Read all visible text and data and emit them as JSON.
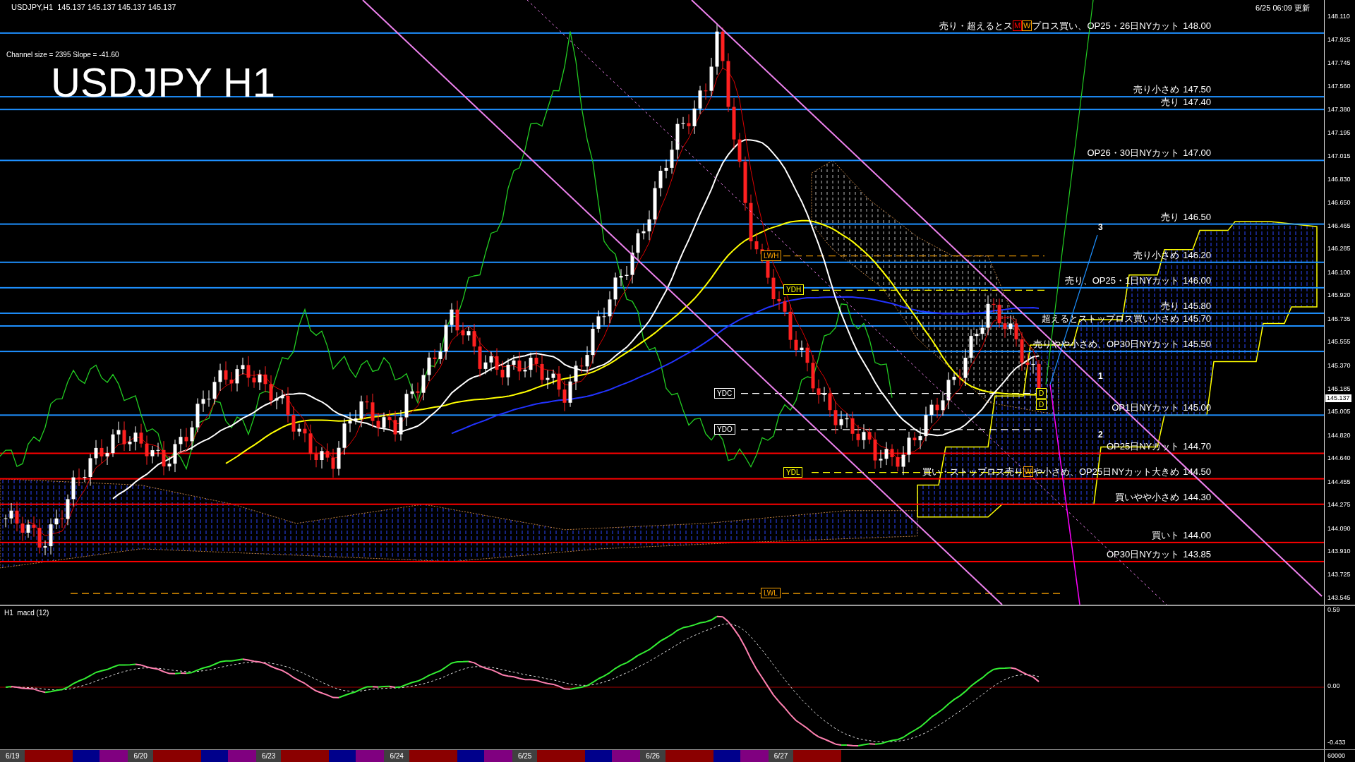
{
  "header": "USDJPY,H1  145.137 145.137 145.137 145.137",
  "updated": "6/25 06:09 更新",
  "channel_info": "Channel size = 2395 Slope = -41.60",
  "chart_title": "USDJPY H1",
  "levels": [
    {
      "parts": [
        {
          "kind": "text",
          "text": "売り・超えるとス"
        },
        {
          "kind": "badge",
          "text": "M",
          "color": "#ff0000"
        },
        {
          "kind": "badge",
          "text": "W",
          "color": "#ffa500"
        },
        {
          "kind": "text",
          "text": "プロス買い、OP25・26日NYカット"
        }
      ],
      "price": "148.00",
      "color": "#1e90ff"
    },
    {
      "parts": [
        {
          "kind": "text",
          "text": "売り小さめ"
        }
      ],
      "price": "147.50",
      "color": "#1e90ff"
    },
    {
      "parts": [
        {
          "kind": "text",
          "text": "売り"
        }
      ],
      "price": "147.40",
      "color": "#1e90ff"
    },
    {
      "parts": [
        {
          "kind": "text",
          "text": "OP26・30日NYカット"
        }
      ],
      "price": "147.00",
      "color": "#1e90ff"
    },
    {
      "parts": [
        {
          "kind": "text",
          "text": "売り"
        }
      ],
      "price": "146.50",
      "color": "#1e90ff"
    },
    {
      "parts": [
        {
          "kind": "text",
          "text": "売り小さめ"
        }
      ],
      "price": "146.20",
      "color": "#1e90ff"
    },
    {
      "parts": [
        {
          "kind": "text",
          "text": "売り、OP25・1日NYカット"
        }
      ],
      "price": "146.00",
      "color": "#1e90ff"
    },
    {
      "parts": [
        {
          "kind": "text",
          "text": "売り"
        }
      ],
      "price": "145.80",
      "color": "#1e90ff"
    },
    {
      "parts": [
        {
          "kind": "text",
          "text": "超えるとストップロス買い小さめ"
        }
      ],
      "price": "145.70",
      "color": "#1e90ff"
    },
    {
      "parts": [
        {
          "kind": "text",
          "text": "売りやや小さめ、OP30日NYカット"
        }
      ],
      "price": "145.50",
      "color": "#1e90ff"
    },
    {
      "parts": [
        {
          "kind": "text",
          "text": "OP1日NYカット"
        }
      ],
      "price": "145.00",
      "color": "#1e90ff"
    },
    {
      "parts": [
        {
          "kind": "text",
          "text": "OP25日NYカット"
        }
      ],
      "price": "144.70",
      "color": "#ff0000"
    },
    {
      "parts": [
        {
          "kind": "text",
          "text": "買い・ストップロス売り"
        },
        {
          "kind": "badge",
          "text": "W",
          "color": "#ffa500"
        },
        {
          "kind": "text",
          "text": "や小さめ、OP25日NYカット大きめ"
        }
      ],
      "price": "144.50",
      "color": "#ff0000"
    },
    {
      "parts": [
        {
          "kind": "text",
          "text": "買いやや小さめ"
        }
      ],
      "price": "144.30",
      "color": "#ff0000"
    },
    {
      "parts": [
        {
          "kind": "text",
          "text": "買いト"
        }
      ],
      "price": "144.00",
      "color": "#ff0000"
    },
    {
      "parts": [
        {
          "kind": "text",
          "text": "OP30日NYカット"
        }
      ],
      "price": "143.85",
      "color": "#ff0000"
    }
  ],
  "markers": [
    {
      "label": "LWH",
      "color": "#ffa500"
    },
    {
      "label": "YDH",
      "color": "#ffff00"
    },
    {
      "label": "YDC",
      "color": "#ffffff"
    },
    {
      "label": "YDO",
      "color": "#ffffff"
    },
    {
      "label": "YDL",
      "color": "#ffff00"
    },
    {
      "label": "LWL",
      "color": "#ffa500"
    },
    {
      "label": "D",
      "color": "#ffff00"
    },
    {
      "label": "D",
      "color": "#ffff00"
    }
  ],
  "wave_labels": [
    "3",
    "1",
    "2"
  ],
  "price_axis": {
    "ticks": [
      "148.110",
      "147.925",
      "147.745",
      "147.560",
      "147.380",
      "147.195",
      "147.015",
      "146.830",
      "146.650",
      "146.465",
      "146.285",
      "146.100",
      "145.920",
      "145.735",
      "145.555",
      "145.370",
      "145.185",
      "145.005",
      "144.820",
      "144.640",
      "144.455",
      "144.275",
      "144.090",
      "143.910",
      "143.725",
      "143.545"
    ],
    "current": "145.137"
  },
  "macd": {
    "title": "H1  macd (12)",
    "ticks": [
      "0.59",
      "0.00",
      "-0.433"
    ]
  },
  "dates": [
    "6/19",
    "6/20",
    "6/23",
    "6/24",
    "6/25",
    "6/26",
    "6/27"
  ],
  "date_axis_end": "60000"
}
